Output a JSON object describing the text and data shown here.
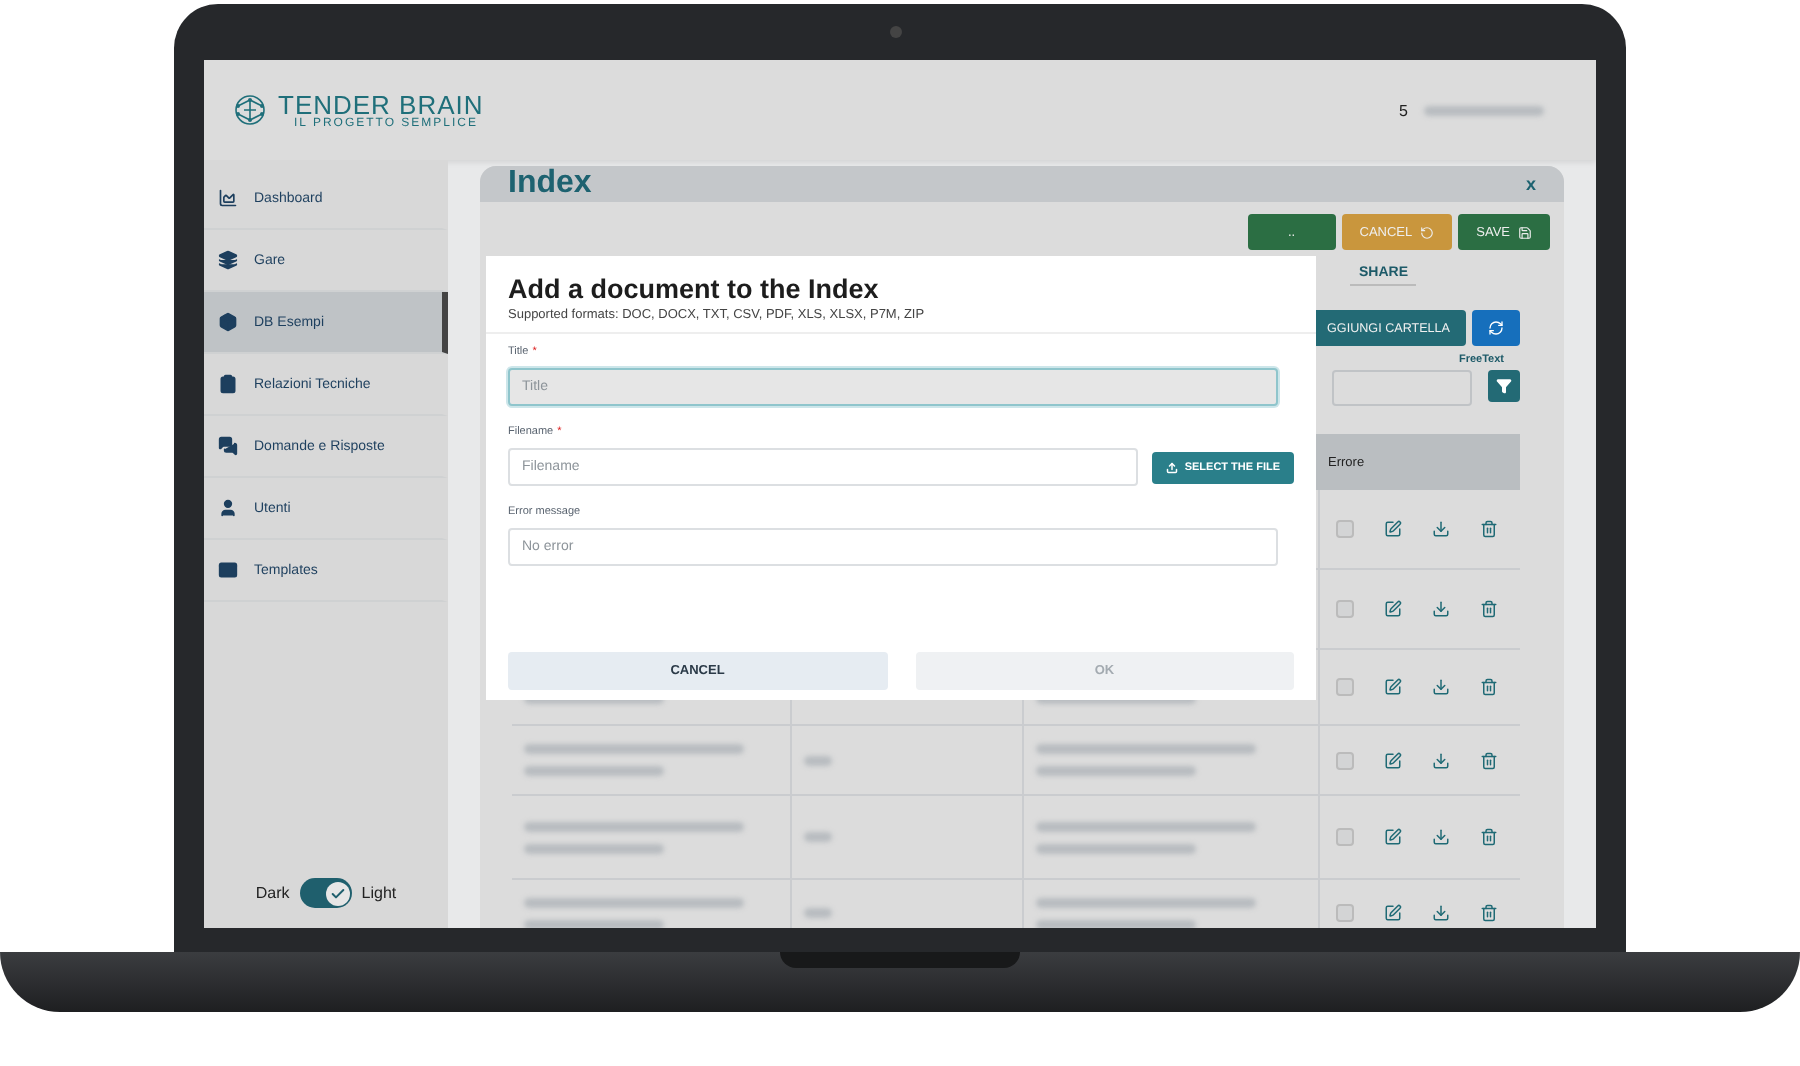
{
  "header": {
    "logo_title": "TENDER BRAIN",
    "logo_subtitle": "IL PROGETTO SEMPLICE",
    "count": "5"
  },
  "sidebar": {
    "items": [
      {
        "label": "Dashboard",
        "selected": false
      },
      {
        "label": "Gare",
        "selected": false
      },
      {
        "label": "DB Esempi",
        "selected": true
      },
      {
        "label": "Relazioni Tecniche",
        "selected": false
      },
      {
        "label": "Domande e Risposte",
        "selected": false
      },
      {
        "label": "Utenti",
        "selected": false
      },
      {
        "label": "Templates",
        "selected": false
      }
    ],
    "theme_toggle": {
      "left_label": "Dark",
      "right_label": "Light",
      "on": true
    }
  },
  "page": {
    "title": "Index",
    "close": "x",
    "toolbar": [
      {
        "label": "..",
        "kind": "success"
      },
      {
        "label": "CANCEL",
        "kind": "warning"
      },
      {
        "label": "SAVE",
        "kind": "success"
      }
    ],
    "tabs": [
      {
        "label": "SHARE",
        "selected": true
      }
    ],
    "add_folder_button": "GGIUNGI CARTELLA",
    "filter_label": "FreeText",
    "table": {
      "columns": [
        "Errore"
      ],
      "rows": [
        {
          "checked": false
        },
        {
          "checked": false
        },
        {
          "checked": false
        },
        {
          "checked": false
        },
        {
          "checked": false
        },
        {
          "checked": false
        }
      ]
    }
  },
  "modal": {
    "title": "Add a document to the Index",
    "subtitle": "Supported formats: DOC, DOCX, TXT, CSV, PDF, XLS, XLSX, P7M, ZIP",
    "fields": [
      {
        "label": "Title",
        "required_mark": "*",
        "placeholder": "Title",
        "focused": true
      },
      {
        "label": "Filename",
        "required_mark": "*",
        "placeholder": "Filename",
        "focused": false,
        "button": "SELECT THE FILE"
      },
      {
        "label": "Error message",
        "placeholder": "No error",
        "focused": false
      }
    ],
    "buttons": [
      {
        "label": "CANCEL",
        "disabled": false
      },
      {
        "label": "OK",
        "disabled": true
      }
    ]
  }
}
